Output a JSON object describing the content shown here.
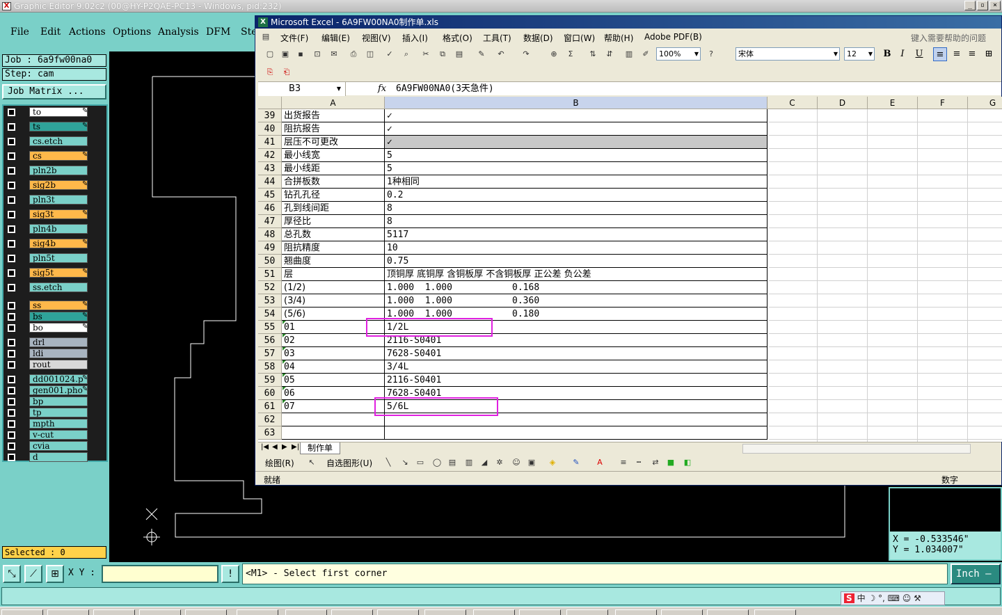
{
  "ge": {
    "title": "Graphic Editor 9.02c2 (00@HY-P2QAE-PC13 - Windows, pid:232)",
    "menu": [
      "File",
      "Edit",
      "Actions",
      "Options",
      "Analysis",
      "DFM",
      "Ste"
    ],
    "job": "Job : 6a9fw00na0",
    "step": "Step: cam",
    "job_matrix": "Job Matrix ...",
    "layers": [
      {
        "name": "to",
        "color": "#ffffff",
        "flag": "✎"
      },
      {
        "name": "ts",
        "color": "#2fa39a",
        "flag": "✎"
      },
      {
        "name": "cs.etch",
        "color": "#7ad0c8",
        "flag": ""
      },
      {
        "name": "cs",
        "color": "#ffb84a",
        "flag": "✎"
      },
      {
        "name": "pln2b",
        "color": "#7ad0c8",
        "flag": ""
      },
      {
        "name": "sig2b",
        "color": "#ffb84a",
        "flag": "✎"
      },
      {
        "name": "pln3t",
        "color": "#7ad0c8",
        "flag": ""
      },
      {
        "name": "sig3t",
        "color": "#ffb84a",
        "flag": "✎"
      },
      {
        "name": "pln4b",
        "color": "#7ad0c8",
        "flag": ""
      },
      {
        "name": "sig4b",
        "color": "#ffb84a",
        "flag": "✎"
      },
      {
        "name": "pln5t",
        "color": "#7ad0c8",
        "flag": ""
      },
      {
        "name": "sig5t",
        "color": "#ffb84a",
        "flag": "✎"
      },
      {
        "name": "ss.etch",
        "color": "#7ad0c8",
        "flag": ""
      },
      {
        "name": "ss",
        "color": "#ffb84a",
        "flag": "✎"
      },
      {
        "name": "bs",
        "color": "#2fa39a",
        "flag": "✎"
      },
      {
        "name": "bo",
        "color": "#ffffff",
        "flag": "✎"
      },
      {
        "name": "drl",
        "color": "#a8b4c0",
        "flag": ""
      },
      {
        "name": "ldi",
        "color": "#a8b4c0",
        "flag": ""
      },
      {
        "name": "rout",
        "color": "#d8d8d8",
        "flag": ""
      },
      {
        "name": "dd001024.p",
        "color": "#7ad0c8",
        "flag": "✎"
      },
      {
        "name": "gen001.pho",
        "color": "#7ad0c8",
        "flag": "✎"
      },
      {
        "name": "bp",
        "color": "#7ad0c8",
        "flag": ""
      },
      {
        "name": "tp",
        "color": "#7ad0c8",
        "flag": ""
      },
      {
        "name": "mpth",
        "color": "#7ad0c8",
        "flag": ""
      },
      {
        "name": "v-cut",
        "color": "#7ad0c8",
        "flag": ""
      },
      {
        "name": "cvia",
        "color": "#7ad0c8",
        "flag": ""
      },
      {
        "name": "d",
        "color": "#7ad0c8",
        "flag": ""
      }
    ],
    "selected": "Selected : 0",
    "coords": {
      "x": "X = -0.533546\"",
      "y": "Y = 1.034007\""
    },
    "xy_label": "X Y :",
    "xy_value": "",
    "message": "<M1> - Select first corner",
    "units": "Inch",
    "units_arrow": "–"
  },
  "excel": {
    "title": "Microsoft Excel - 6A9FW00NA0制作单.xls",
    "menu": [
      "文件(F)",
      "编辑(E)",
      "视图(V)",
      "插入(I)",
      "格式(O)",
      "工具(T)",
      "数据(D)",
      "窗口(W)",
      "帮助(H)",
      "Adobe PDF(B)"
    ],
    "help_placeholder": "键入需要帮助的问题",
    "zoom": "100%",
    "font": "宋体",
    "font_size": "12",
    "name_box": "B3",
    "formula": "6A9FW00NA0(3天急件)",
    "columns": [
      "A",
      "B",
      "C",
      "D",
      "E",
      "F",
      "G"
    ],
    "rows": [
      {
        "n": "39",
        "a": "出货报告",
        "b": "✓"
      },
      {
        "n": "40",
        "a": "阻抗报告",
        "b": "✓"
      },
      {
        "n": "41",
        "a": "层压不可更改",
        "b": "✓"
      },
      {
        "n": "42",
        "a": "最小线宽",
        "b": "5"
      },
      {
        "n": "43",
        "a": "最小线距",
        "b": "5"
      },
      {
        "n": "44",
        "a": "合拼板数",
        "b": "1种相同"
      },
      {
        "n": "45",
        "a": "钻孔孔径",
        "b": "0.2"
      },
      {
        "n": "46",
        "a": "孔到线间距",
        "b": "8"
      },
      {
        "n": "47",
        "a": "厚径比",
        "b": "8"
      },
      {
        "n": "48",
        "a": "总孔数",
        "b": "5117"
      },
      {
        "n": "49",
        "a": "阻抗精度",
        "b": "10"
      },
      {
        "n": "50",
        "a": "翘曲度",
        "b": "0.75"
      },
      {
        "n": "51",
        "a": "层",
        "b": "顶铜厚 底铜厚 含铜板厚 不含铜板厚 正公差 负公差"
      },
      {
        "n": "52",
        "a": "(1/2)",
        "b": "1.000  1.000           0.168"
      },
      {
        "n": "53",
        "a": "(3/4)",
        "b": "1.000  1.000           0.360"
      },
      {
        "n": "54",
        "a": "(5/6)",
        "b": "1.000  1.000           0.180"
      },
      {
        "n": "55",
        "a": "01",
        "b": "1/2L"
      },
      {
        "n": "56",
        "a": "02",
        "b": "2116-S0401"
      },
      {
        "n": "57",
        "a": "03",
        "b": "7628-S0401"
      },
      {
        "n": "58",
        "a": "04",
        "b": "3/4L"
      },
      {
        "n": "59",
        "a": "05",
        "b": "2116-S0401"
      },
      {
        "n": "60",
        "a": "06",
        "b": "7628-S0401"
      },
      {
        "n": "61",
        "a": "07",
        "b": "5/6L"
      },
      {
        "n": "62",
        "a": "",
        "b": ""
      },
      {
        "n": "63",
        "a": "",
        "b": ""
      }
    ],
    "sheet_tab": "制作单",
    "draw_label": "绘图(R)",
    "autoshape_label": "自选图形(U)",
    "status_left": "就绪",
    "status_right": "数字"
  },
  "ime": {
    "s": "S",
    "text": "中 ☽ °, ⌨ ☺ ⚒"
  }
}
